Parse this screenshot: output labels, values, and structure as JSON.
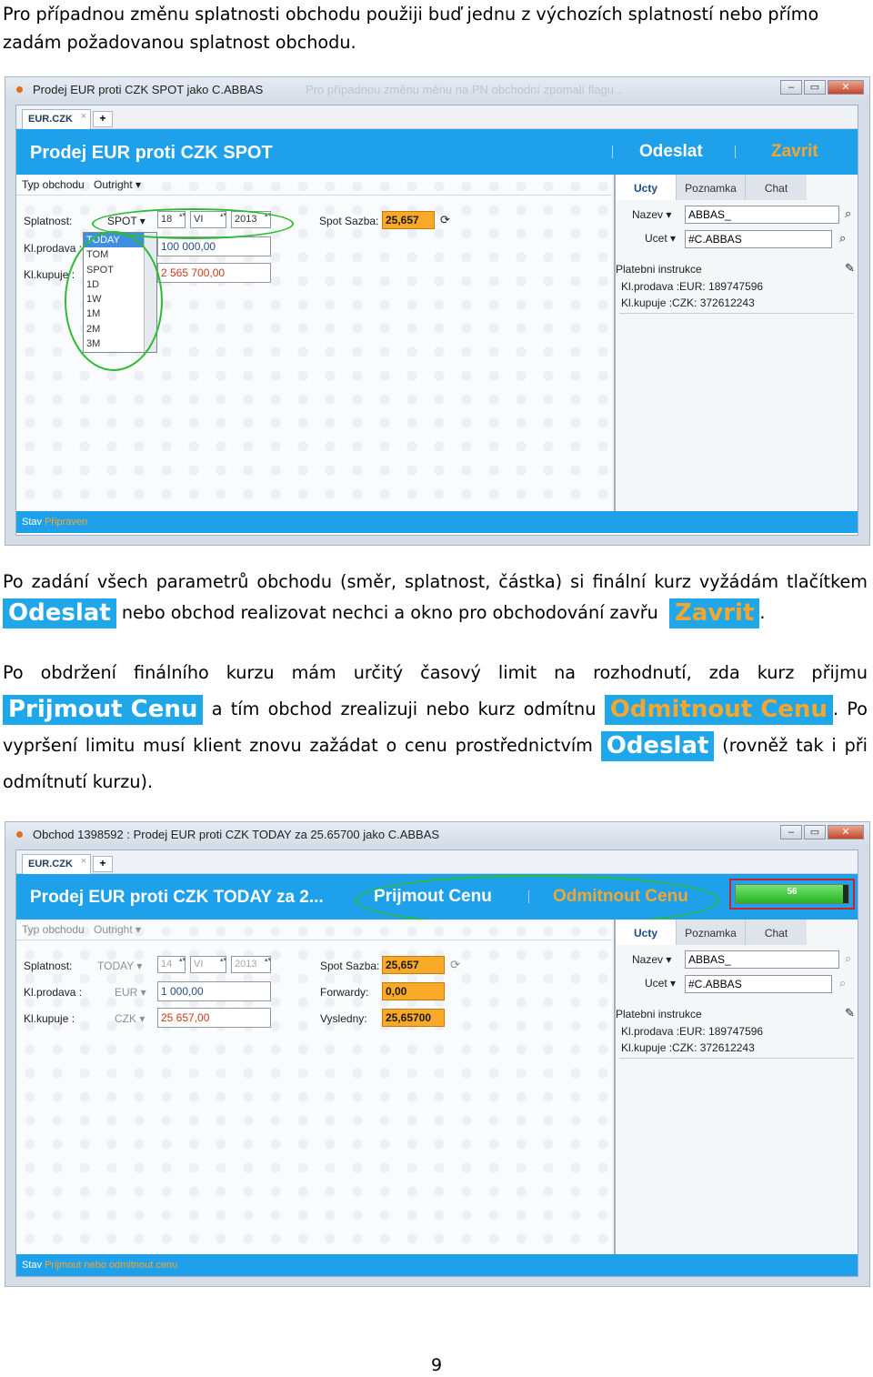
{
  "intro_text": "Pro případnou změnu splatnosti obchodu použiji buď jednu z výchozích splatností nebo přímo zadám požadovanou splatnost obchodu.",
  "para2": {
    "part1": "Po zadání všech parametrů obchodu (směr, splatnost, částka) si finální kurz vyžádám tlačítkem",
    "btn1": "Odeslat",
    "part2": "nebo obchod realizovat nechci a okno pro obchodování zavřu",
    "btn2": "Zavrit",
    "part3": "."
  },
  "para3": {
    "part1": "Po obdržení finálního kurzu mám určitý časový limit na rozhodnutí, zda kurz přijmu",
    "btn1": "Prijmout Cenu",
    "part2": "a tím obchod zrealizuji nebo kurz odmítnu",
    "btn2": "Odmitnout Cenu",
    "part3": ". Po vypršení limitu musí klient znovu zažádat o cenu prostřednictvím",
    "btn3": "Odeslat",
    "part4": "(rovněž tak i při odmítnutí kurzu)."
  },
  "window1": {
    "title": "Prodej EUR proti CZK SPOT jako C.ABBAS",
    "ghost_title": "Pro případnou změnu měnu na PN obchodní zpomalí flagu ..",
    "tab": "EUR.CZK",
    "header_title": "Prodej EUR proti CZK SPOT",
    "btn_send": "Odeslat",
    "btn_close": "Zavrit",
    "typ_label": "Typ obchodu",
    "typ_value": "Outright",
    "splatnost_label": "Splatnost:",
    "splatnost_value": "SPOT",
    "day": "18",
    "month": "VI",
    "year": "2013",
    "spot_label": "Spot Sazba:",
    "spot_value": "25,657",
    "prodava_label": "Kl.prodava :",
    "prodava_value": "100 000,00",
    "kupuje_label": "Kl.kupuje :",
    "kupuje_value": "2 565 700,00",
    "dropdown": [
      "TODAY",
      "TOM",
      "SPOT",
      "1D",
      "1W",
      "1M",
      "2M",
      "3M"
    ],
    "status_label": "Stav",
    "status_value": "Připraven"
  },
  "window2": {
    "title": "Obchod 1398592 : Prodej EUR proti CZK TODAY za 25.65700 jako C.ABBAS",
    "tab": "EUR.CZK",
    "header_title": "Prodej EUR proti CZK TODAY za 2...",
    "btn_accept": "Prijmout Cenu",
    "btn_reject": "Odmitnout Cenu",
    "progress_value": "56",
    "progress_fraction": 0.95,
    "typ_label": "Typ obchodu",
    "typ_value": "Outright",
    "splatnost_label": "Splatnost:",
    "splatnost_value": "TODAY",
    "day": "14",
    "month": "VI",
    "year": "2013",
    "prodava_label": "Kl.prodava :",
    "prodava_currency": "EUR",
    "prodava_value": "1 000,00",
    "kupuje_label": "Kl.kupuje :",
    "kupuje_currency": "CZK",
    "kupuje_value": "25 657,00",
    "spot_label": "Spot Sazba:",
    "spot_value": "25,657",
    "forward_label": "Forwardy:",
    "forward_value": "0,00",
    "result_label": "Vysledny:",
    "result_value": "25,65700",
    "status_label": "Stav",
    "status_value": "Prijmout nebo odmitnout cenu"
  },
  "right_panel": {
    "tabs": [
      "Ucty",
      "Poznamka",
      "Chat"
    ],
    "nazev_label": "Nazev",
    "nazev_value": "ABBAS_",
    "ucet_label": "Ucet",
    "ucet_value": "#C.ABBAS",
    "instructions_title": "Platebni instrukce",
    "instr1": "Kl.prodava :EUR: 189747596",
    "instr2": "Kl.kupuje :CZK: 372612243"
  },
  "page_number": "9",
  "colors": {
    "header_blue": "#1ea0ea",
    "orange": "#f7a927",
    "highlight_green": "#2dbb34",
    "progress_border": "#c8232c"
  }
}
